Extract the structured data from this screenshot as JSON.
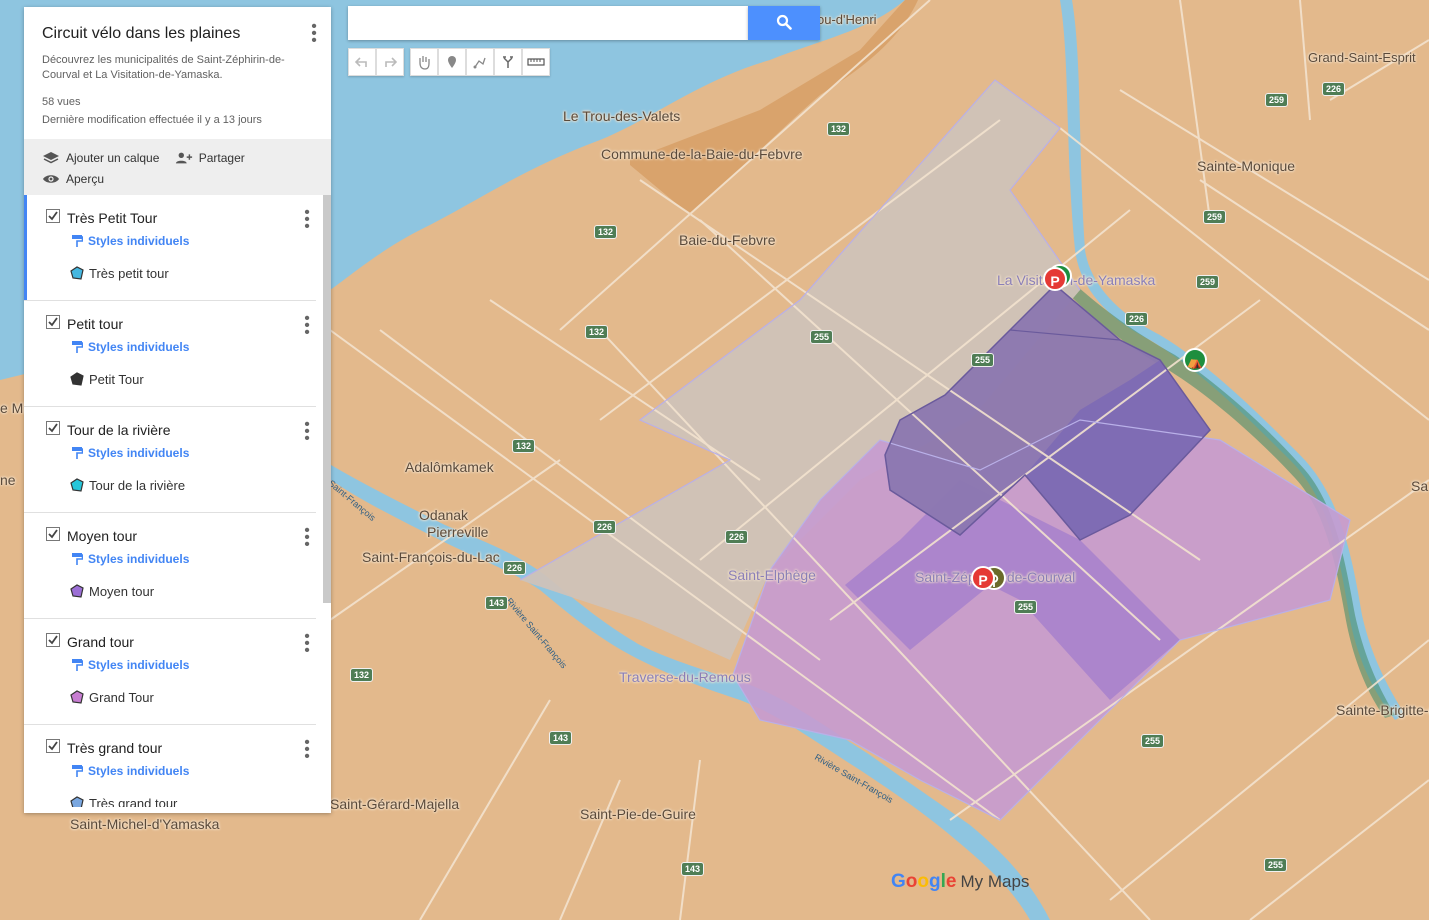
{
  "map_title": "Circuit vélo dans les plaines",
  "description": "Découvrez les municipalités de Saint-Zéphirin-de-Courval et La Visitation-de-Yamaska.",
  "views": "58 vues",
  "last_modified": "Dernière modification effectuée il y a 13 jours",
  "actions": {
    "add_layer": "Ajouter un calque",
    "share": "Partager",
    "preview": "Aperçu"
  },
  "layers": [
    {
      "name": "Très Petit Tour",
      "style": "Styles individuels",
      "feature": "Très petit tour",
      "color": "#45b7e0"
    },
    {
      "name": "Petit tour",
      "style": "Styles individuels",
      "feature": "Petit Tour",
      "color": "#333333"
    },
    {
      "name": "Tour de la rivière",
      "style": "Styles individuels",
      "feature": "Tour de la rivière",
      "color": "#26c6da"
    },
    {
      "name": "Moyen tour",
      "style": "Styles individuels",
      "feature": "Moyen tour",
      "color": "#9c6fd6"
    },
    {
      "name": "Grand tour",
      "style": "Styles individuels",
      "feature": "Grand Tour",
      "color": "#c77dd1"
    },
    {
      "name": "Très grand tour",
      "style": "Styles individuels",
      "feature": "Très grand tour",
      "color": "#7aa7e0"
    }
  ],
  "search": {
    "placeholder": "",
    "value": ""
  },
  "map_labels": {
    "l1": "Grand-Saint-Esprit",
    "l2": "Le Trou-des-Valets",
    "l3": "Commune-de-la-Baie-du-Febvre",
    "l4": "Sainte-Monique",
    "l5": "Baie-du-Febvre",
    "l6": "La Visitation-de-Yamaska",
    "l7": "Adalômkamek",
    "l8": "Odanak",
    "l9": "Pierreville",
    "l10": "Saint-François-du-Lac",
    "l11": "Saint-Elphège",
    "l12": "Saint-Zéphirin-de-Courval",
    "l13": "Traverse-du-Remous",
    "l14": "Saint-Pie-de-Guire",
    "l15": "Saint-Gérard-Majella",
    "l16": "Saint-Michel-d'Yamaska",
    "l17": "Sainte-Brigitte-des-Saults",
    "l18": "ou-d'Henri",
    "l19": "Sa",
    "l20": "e Mi",
    "l21": "ne",
    "r1": "Rivière Saint-François",
    "r2": "Rivière Saint-François",
    "r3": "Saint-François"
  },
  "route_shields": [
    "132",
    "132",
    "132",
    "132",
    "132",
    "226",
    "226",
    "226",
    "226",
    "226",
    "255",
    "255",
    "255",
    "255",
    "255",
    "143",
    "143",
    "143",
    "259",
    "259",
    "259"
  ],
  "logo": {
    "google": "Google",
    "mymaps": "My Maps"
  },
  "colors": {
    "land": "#e3b98c",
    "water": "#8ec5e0",
    "accent": "#4285f4"
  }
}
